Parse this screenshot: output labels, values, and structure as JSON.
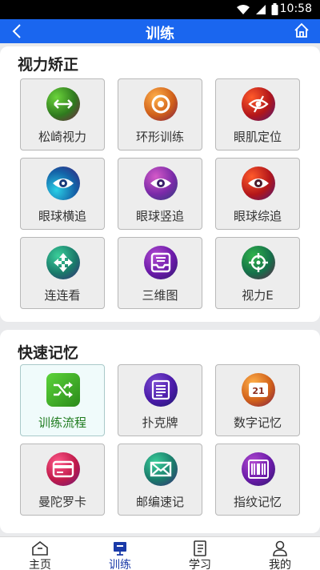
{
  "status_bar": {
    "time": "10:58"
  },
  "header": {
    "title": "训练"
  },
  "sections": [
    {
      "title": "视力矫正",
      "items": [
        {
          "label": "松崎视力",
          "icon": "horizontal-arrows-icon"
        },
        {
          "label": "环形训练",
          "icon": "target-ring-icon"
        },
        {
          "label": "眼肌定位",
          "icon": "eye-slash-icon"
        },
        {
          "label": "眼球横追",
          "icon": "eye-icon"
        },
        {
          "label": "眼球竖追",
          "icon": "eye-icon"
        },
        {
          "label": "眼球综追",
          "icon": "eye-icon"
        },
        {
          "label": "连连看",
          "icon": "four-way-arrows-icon"
        },
        {
          "label": "三维图",
          "icon": "tray-icon"
        },
        {
          "label": "视力E",
          "icon": "crosshair-icon"
        }
      ]
    },
    {
      "title": "快速记忆",
      "items": [
        {
          "label": "训练流程",
          "icon": "shuffle-icon"
        },
        {
          "label": "扑克牌",
          "icon": "list-card-icon"
        },
        {
          "label": "数字记忆",
          "icon": "number-card-icon"
        },
        {
          "label": "曼陀罗卡",
          "icon": "credit-card-icon"
        },
        {
          "label": "邮编速记",
          "icon": "envelope-icon"
        },
        {
          "label": "指纹记忆",
          "icon": "barcode-icon"
        }
      ]
    }
  ],
  "bottom_nav": [
    {
      "label": "主页",
      "icon": "home-icon"
    },
    {
      "label": "训练",
      "icon": "monitor-icon",
      "active": true
    },
    {
      "label": "学习",
      "icon": "notebook-icon"
    },
    {
      "label": "我的",
      "icon": "person-icon"
    }
  ],
  "colors": {
    "accent": "#1a66ef",
    "active_nav": "#1a3aa8",
    "selected_label": "#1e7b1e"
  }
}
